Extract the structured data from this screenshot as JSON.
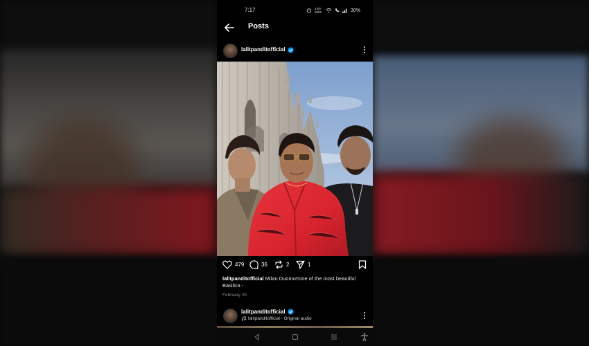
{
  "status_bar": {
    "time": "7:17",
    "net_speed": "2.00 KB/S",
    "battery": "30%"
  },
  "header": {
    "title": "Posts"
  },
  "post": {
    "username": "lalitpanditofficial",
    "likes": "479",
    "comments": "36",
    "reposts": "2",
    "shares": "1",
    "caption_username": "lalitpanditofficial",
    "caption_text": "Milan Duomo!!one of the most beautiful Basilica -",
    "date": "February 25"
  },
  "next_post": {
    "username": "lalitpanditofficial",
    "audio": "lalitpanditofficial · Original audio"
  },
  "colors": {
    "verified": "#0095f6",
    "background": "#000000",
    "jacket": "#d8242e"
  },
  "icons": [
    "back-arrow-icon",
    "verified-icon",
    "more-icon",
    "heart-icon",
    "comment-icon",
    "repost-icon",
    "send-icon",
    "bookmark-icon",
    "music-note-icon",
    "nav-back-icon",
    "nav-home-icon",
    "nav-recents-icon",
    "accessibility-icon"
  ]
}
